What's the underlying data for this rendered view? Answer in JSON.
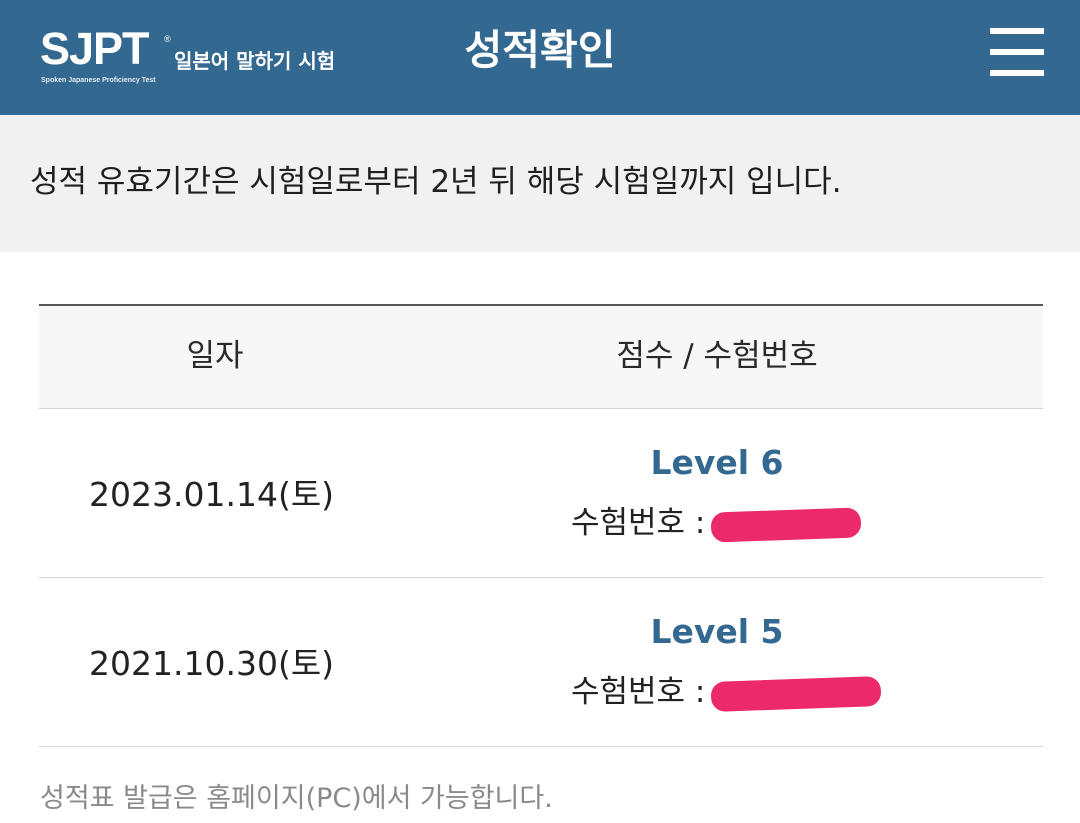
{
  "header": {
    "logo": {
      "main": "SJPT",
      "reg": "®",
      "korean": "일본어 말하기 시험",
      "subtitle": "Spoken Japanese Proficiency Test"
    },
    "title": "성적확인",
    "menu_icon": "hamburger-menu-icon"
  },
  "notice": {
    "text": "성적 유효기간은 시험일로부터 2년 뒤 해당 시험일까지 입니다."
  },
  "table": {
    "columns": [
      "일자",
      "점수 / 수험번호"
    ],
    "rows": [
      {
        "date": "2023.01.14(토)",
        "level": "Level 6",
        "exam_label": "수험번호 :",
        "exam_number_redacted": true
      },
      {
        "date": "2021.10.30(토)",
        "level": "Level 5",
        "exam_label": "수험번호 :",
        "exam_number_redacted": true
      }
    ]
  },
  "footer": {
    "note": "성적표 발급은 홈페이지(PC)에서 가능합니다."
  },
  "colors": {
    "header_bg": "#336891",
    "accent": "#336891",
    "notice_bg": "#f1f1f1",
    "redaction": "#ec2a6b"
  }
}
